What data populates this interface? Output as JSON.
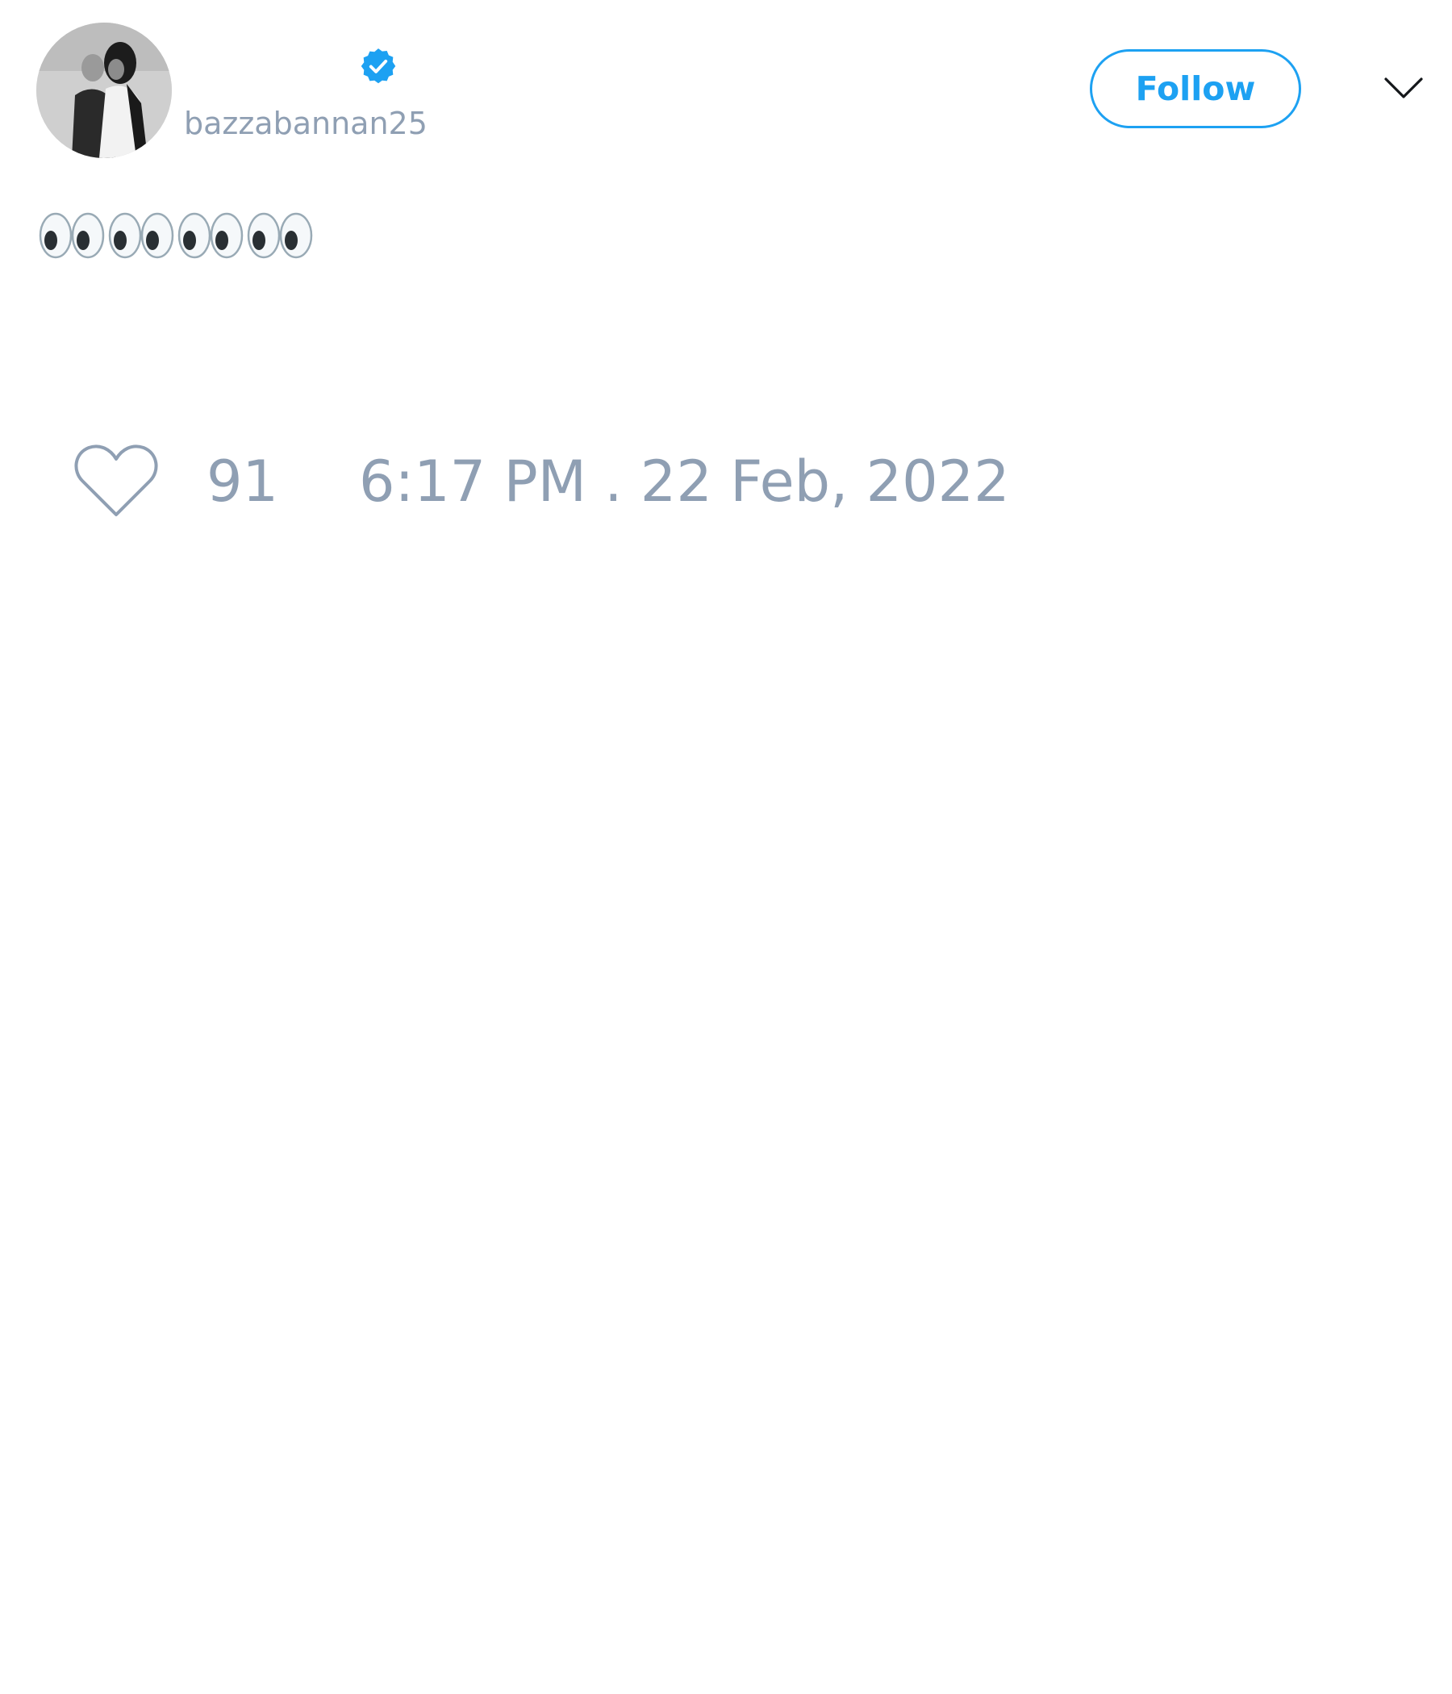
{
  "author": {
    "display_name": "",
    "username": "bazzabannan25",
    "verified": true,
    "avatar_icon": "avatar-photo"
  },
  "header": {
    "follow_label": "Follow",
    "menu_icon": "chevron-down-icon"
  },
  "tweet": {
    "text": "👀👀👀👀",
    "emoji_icon": "eyes-icon",
    "emoji_count": 4
  },
  "footer": {
    "like_icon": "heart-icon",
    "like_count": "91",
    "timestamp": "6:17 PM . 22 Feb, 2022"
  },
  "colors": {
    "accent": "#1da1f2",
    "muted_text": "#8f9fb3",
    "background": "#ffffff"
  }
}
